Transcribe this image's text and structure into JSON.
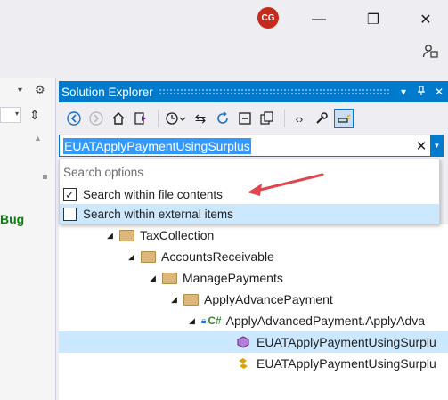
{
  "titlebar": {
    "avatar_initials": "CG",
    "minimize": "—",
    "maximize": "❐",
    "close": "✕",
    "feedback_icon": "person-feedback-icon"
  },
  "left_pane": {
    "bug_text": "Bug"
  },
  "solution_explorer": {
    "title": "Solution Explorer",
    "header_buttons": [
      "▾",
      "⊣",
      "✕"
    ]
  },
  "toolbar": {
    "icons": [
      "back-icon",
      "forward-icon",
      "home-icon",
      "switch-views-icon",
      "pending-changes-filter-icon",
      "sync-icon",
      "refresh-icon",
      "collapse-all-icon",
      "show-all-files-icon",
      "view-code-icon",
      "properties-icon",
      "preview-icon"
    ]
  },
  "search": {
    "value": "EUATApplyPaymentUsingSurplus",
    "clear": "✕",
    "dropdown": "▼"
  },
  "search_options": {
    "title": "Search options",
    "items": [
      {
        "label": "Search within file contents",
        "checked": true
      },
      {
        "label": "Search within external items",
        "checked": false
      }
    ]
  },
  "tree": {
    "items": [
      {
        "label": "TaxCollection"
      },
      {
        "label": "AccountsReceivable"
      },
      {
        "label": "ManagePayments"
      },
      {
        "label": "ApplyAdvancePayment"
      },
      {
        "label": "ApplyAdvancedPayment.ApplyAdva"
      },
      {
        "label": "EUATApplyPaymentUsingSurplu"
      },
      {
        "label": "EUATApplyPaymentUsingSurplu"
      }
    ]
  },
  "colors": {
    "accent": "#007acc",
    "arrow": "#e0474c",
    "selection": "#cce8ff"
  }
}
